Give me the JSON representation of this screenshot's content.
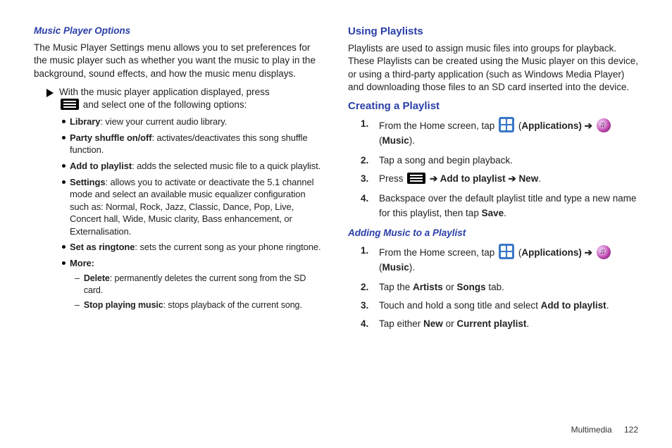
{
  "left": {
    "h1": "Music Player Options",
    "p1": "The Music Player Settings menu allows you to set preferences for the music player such as whether you want the music to play in the background, sound effects, and how the music menu displays.",
    "arrow_line1": "With the music player application displayed, press",
    "arrow_line2": " and select one of the following options:",
    "b1_bold": "Library",
    "b1_rest": ": view your current audio library.",
    "b2_bold": "Party shuffle on/off",
    "b2_rest": ": activates/deactivates this song shuffle function.",
    "b3_bold": "Add to playlist",
    "b3_rest": ": adds the selected music file to a quick playlist.",
    "b4_bold": "Settings",
    "b4_rest": ": allows you to activate or deactivate the 5.1 channel mode and select an available music equalizer configuration such as: Normal, Rock, Jazz, Classic, Dance, Pop, Live, Concert hall, Wide, Music clarity, Bass enhancement, or Externalisation.",
    "b5_bold": "Set as ringtone",
    "b5_rest": ": sets the current song as your phone ringtone.",
    "b6_bold": "More:",
    "d1_bold": "Delete",
    "d1_rest": ": permanently deletes the current song from the SD card.",
    "d2_bold": "Stop playing music",
    "d2_rest": ": stops playback of the current song."
  },
  "right": {
    "h1": "Using Playlists",
    "p1": "Playlists are used to assign music files into groups for playback. These Playlists can be created using the Music player on this device, or using a third-party application (such as Windows Media Player) and downloading those files to an SD card inserted into the device.",
    "h2": "Creating a Playlist",
    "s1_a": "From the Home screen, tap ",
    "s1_b": " (",
    "s1_apps": "Applications",
    "s1_c": ") ➔ ",
    "s1_d": " (",
    "s1_music": "Music",
    "s1_e": ").",
    "s2": "Tap a song and begin playback.",
    "s3_a": "Press ",
    "s3_b": " ➔ ",
    "s3_addto": "Add to playlist",
    "s3_c": " ➔ ",
    "s3_new": "New",
    "s3_d": ".",
    "s4_a": "Backspace over the default playlist title and type a new name for this playlist, then tap ",
    "s4_save": "Save",
    "s4_b": ".",
    "h3": "Adding Music to a Playlist",
    "a1_a": "From the Home screen, tap ",
    "a1_b": " (",
    "a1_apps": "Applications",
    "a1_c": ") ➔ ",
    "a1_d": " (",
    "a1_music": "Music",
    "a1_e": ").",
    "a2_a": "Tap the ",
    "a2_artists": "Artists",
    "a2_b": " or ",
    "a2_songs": "Songs",
    "a2_c": " tab.",
    "a3_a": "Touch and hold a song title and select ",
    "a3_addto": "Add to playlist",
    "a3_b": ".",
    "a4_a": "Tap either ",
    "a4_new": "New",
    "a4_b": " or ",
    "a4_curr": "Current playlist",
    "a4_c": "."
  },
  "footer": {
    "section": "Multimedia",
    "page": "122"
  }
}
